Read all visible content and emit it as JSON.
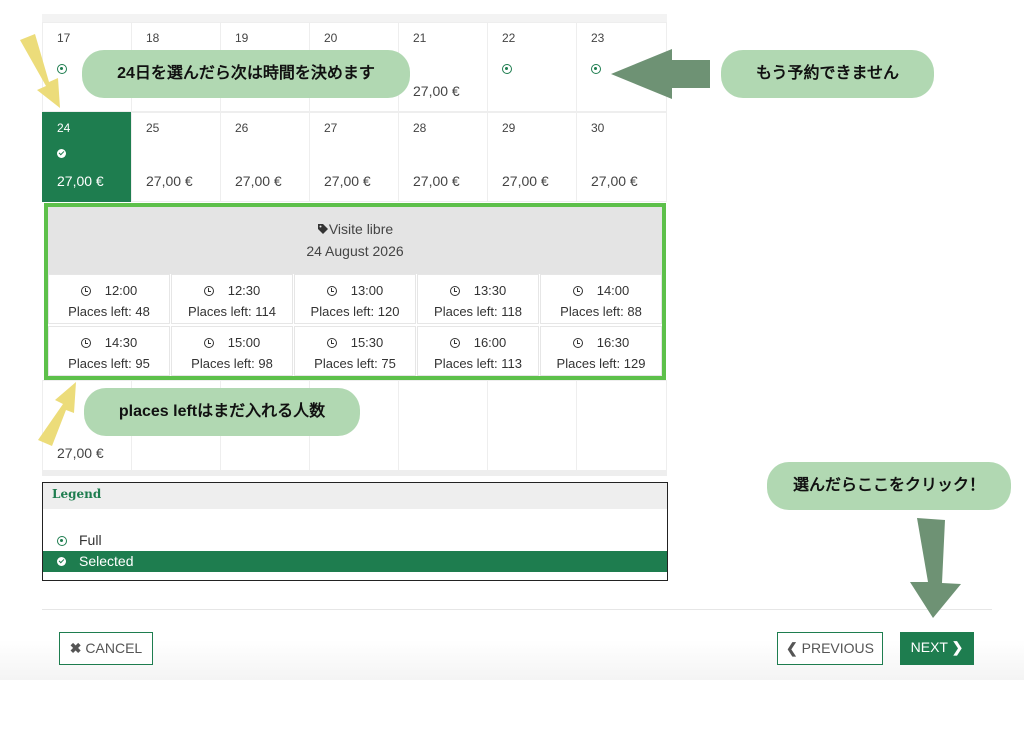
{
  "calendar": {
    "rows": [
      [
        {
          "day": "17",
          "status": "full"
        },
        {
          "day": "18",
          "status": ""
        },
        {
          "day": "19",
          "status": ""
        },
        {
          "day": "20",
          "status": ""
        },
        {
          "day": "21",
          "price": "27,00 €"
        },
        {
          "day": "22",
          "status": "full"
        },
        {
          "day": "23",
          "status": "full"
        }
      ],
      [
        {
          "day": "24",
          "price": "27,00 €",
          "status": "selected"
        },
        {
          "day": "25",
          "price": "27,00 €"
        },
        {
          "day": "26",
          "price": "27,00 €"
        },
        {
          "day": "27",
          "price": "27,00 €"
        },
        {
          "day": "28",
          "price": "27,00 €"
        },
        {
          "day": "29",
          "price": "27,00 €"
        },
        {
          "day": "30",
          "price": "27,00 €"
        }
      ]
    ],
    "bottom_price": "27,00 €"
  },
  "popup": {
    "title": "Visite libre",
    "date": "24 August 2026",
    "slots": [
      {
        "time": "12:00",
        "left": "Places left: 48"
      },
      {
        "time": "12:30",
        "left": "Places left: 114"
      },
      {
        "time": "13:00",
        "left": "Places left: 120"
      },
      {
        "time": "13:30",
        "left": "Places left: 118"
      },
      {
        "time": "14:00",
        "left": "Places left: 88"
      },
      {
        "time": "14:30",
        "left": "Places left: 95"
      },
      {
        "time": "15:00",
        "left": "Places left: 98"
      },
      {
        "time": "15:30",
        "left": "Places left: 75"
      },
      {
        "time": "16:00",
        "left": "Places left: 113"
      },
      {
        "time": "16:30",
        "left": "Places left: 129"
      }
    ]
  },
  "annotations": {
    "choose_time": "24日を選んだら次は時間を決めます",
    "full": "もう予約できません",
    "places_left": "places leftはまだ入れる人数",
    "click_here": "選んだらここをクリック！"
  },
  "legend": {
    "title": "Legend",
    "full": "Full",
    "selected": "Selected"
  },
  "buttons": {
    "cancel": "CANCEL",
    "previous": "PREVIOUS",
    "next": "NEXT"
  },
  "colors": {
    "accent_green": "#1e7d4f",
    "highlight_border": "#5dc04a",
    "bubble_green": "#b1d8b2",
    "arrow_dark_green": "#6e9274",
    "arrow_yellow": "#ecdc7a"
  }
}
